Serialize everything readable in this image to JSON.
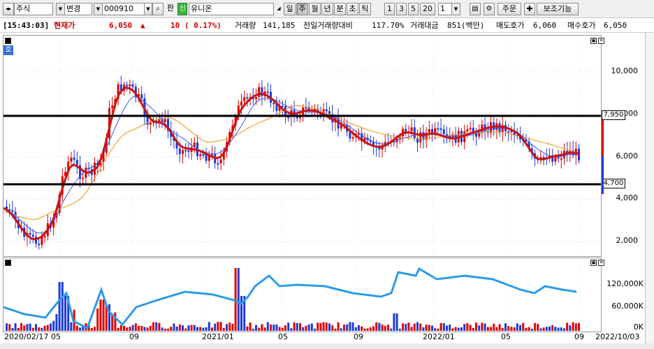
{
  "toolbar": {
    "market": "주식",
    "mode": "변경",
    "code": "000910",
    "pan_label": "판",
    "sin_badge": "신",
    "name": "유니온",
    "periods": [
      "일",
      "주",
      "월",
      "년",
      "분",
      "초",
      "틱"
    ],
    "active_period": "주",
    "intervals": [
      "1",
      "3",
      "5",
      "20"
    ],
    "count": "1",
    "order": "주문",
    "aux": "보조기능"
  },
  "quote": {
    "time": "[15:43:03]",
    "price_label": "현재가",
    "price": "6,050",
    "arrow": "▲",
    "change": "10 ( 0.17%)",
    "volume_label": "거래량",
    "volume": "141,185",
    "prevday_label": "전일거래량대비",
    "prevday": "117.70%",
    "amount_label": "거래대금",
    "amount": "851(백만)",
    "ask_label": "매도호가",
    "ask": "6,060",
    "bid_label": "매수호가",
    "bid": "6,050"
  },
  "price_axis": [
    "10,000",
    "8,000",
    "6,000",
    "4,000",
    "2,000"
  ],
  "volume_axis": [
    "120,000K",
    "60,000K",
    "0K"
  ],
  "levels": [
    "7,950",
    "4,700"
  ],
  "x_axis": [
    "2020/02/17",
    "05",
    "09",
    "2021/01",
    "05",
    "09",
    "2022/01",
    "05",
    "09",
    "2022/10/03"
  ],
  "mode_badge": "호",
  "colors": {
    "up": "#e00000",
    "down": "#1c3bd8",
    "ma_red": "#c81414",
    "ma_blue": "#3a55ff",
    "ma_orange": "#f2a030",
    "vol_line": "#2c9be8"
  }
}
